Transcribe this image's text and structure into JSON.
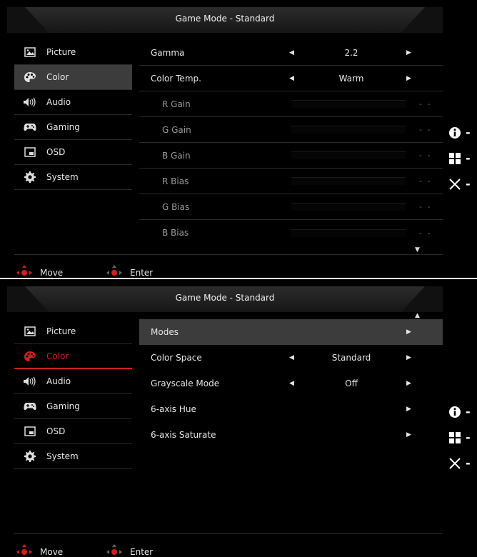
{
  "panel1": {
    "title": "Game Mode - Standard",
    "sidebar": [
      {
        "label": "Picture",
        "icon": "picture-icon"
      },
      {
        "label": "Color",
        "icon": "palette-icon"
      },
      {
        "label": "Audio",
        "icon": "speaker-icon"
      },
      {
        "label": "Gaming",
        "icon": "gamepad-icon"
      },
      {
        "label": "OSD",
        "icon": "osd-icon"
      },
      {
        "label": "System",
        "icon": "gear-icon"
      }
    ],
    "rows": [
      {
        "label": "Gamma",
        "value": "2.2"
      },
      {
        "label": "Color Temp.",
        "value": "Warm"
      },
      {
        "label": "R Gain",
        "value": "- -"
      },
      {
        "label": "G Gain",
        "value": "- -"
      },
      {
        "label": "B Gain",
        "value": "- -"
      },
      {
        "label": "R Bias",
        "value": "- -"
      },
      {
        "label": "G Bias",
        "value": "- -"
      },
      {
        "label": "B Bias",
        "value": "- -"
      }
    ],
    "footer": {
      "move": "Move",
      "enter": "Enter"
    }
  },
  "panel2": {
    "title": "Game Mode - Standard",
    "sidebar": [
      {
        "label": "Picture",
        "icon": "picture-icon"
      },
      {
        "label": "Color",
        "icon": "palette-icon"
      },
      {
        "label": "Audio",
        "icon": "speaker-icon"
      },
      {
        "label": "Gaming",
        "icon": "gamepad-icon"
      },
      {
        "label": "OSD",
        "icon": "osd-icon"
      },
      {
        "label": "System",
        "icon": "gear-icon"
      }
    ],
    "rows": [
      {
        "label": "Modes",
        "value": ""
      },
      {
        "label": "Color Space",
        "value": "Standard"
      },
      {
        "label": "Grayscale Mode",
        "value": "Off"
      },
      {
        "label": "6-axis Hue",
        "value": ""
      },
      {
        "label": "6-axis Saturate",
        "value": ""
      }
    ],
    "footer": {
      "move": "Move",
      "enter": "Enter"
    }
  },
  "hints": [
    {
      "icon": "info-icon",
      "label": "-"
    },
    {
      "icon": "input-icon",
      "label": "-"
    },
    {
      "icon": "close-icon",
      "label": "-"
    }
  ],
  "colors": {
    "selected_red": "#d41e1e",
    "highlight": "#3c3c3c"
  }
}
